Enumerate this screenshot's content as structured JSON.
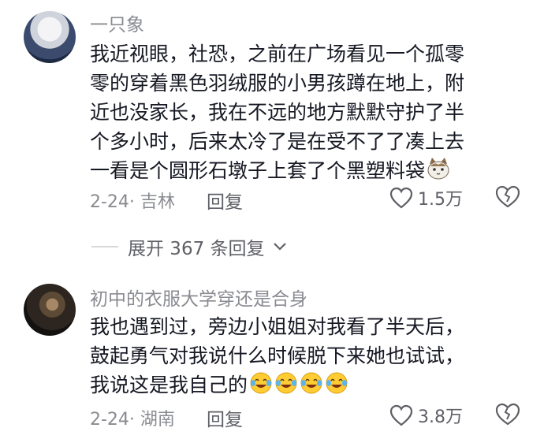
{
  "comments": [
    {
      "username": "一只象",
      "lines": [
        "我近视眼，社恐，之前在广场看见一个孤零",
        "零的穿着黑色羽绒服的小男孩蹲在地上，附",
        "近也没家长，我在不远的地方默默守护了半",
        "个多小时，后来太冷了是在受不了了凑上去",
        "一看是个圆形石墩子上套了个黑塑料袋"
      ],
      "emoji": [
        "cat-face-emoji"
      ],
      "meta": "2-24· 吉林",
      "reply": "回复",
      "likes": "1.5万"
    },
    {
      "username": "初中的衣服大学穿还是合身",
      "lines": [
        "我也遇到过，旁边小姐姐对我看了半天后，",
        "鼓起勇气对我说什么时候脱下来她也试试，",
        "我说这是我自己的"
      ],
      "emoji": [
        "laugh-cry-emoji",
        "laugh-cry-emoji",
        "laugh-cry-emoji",
        "laugh-cry-emoji"
      ],
      "meta": "2-24· 湖南",
      "reply": "回复",
      "likes": "3.8万"
    }
  ],
  "expand_replies": "展开 367 条回复",
  "colors": {
    "text": "#161823",
    "secondary": "#8a8b91",
    "action": "#5f6066"
  }
}
